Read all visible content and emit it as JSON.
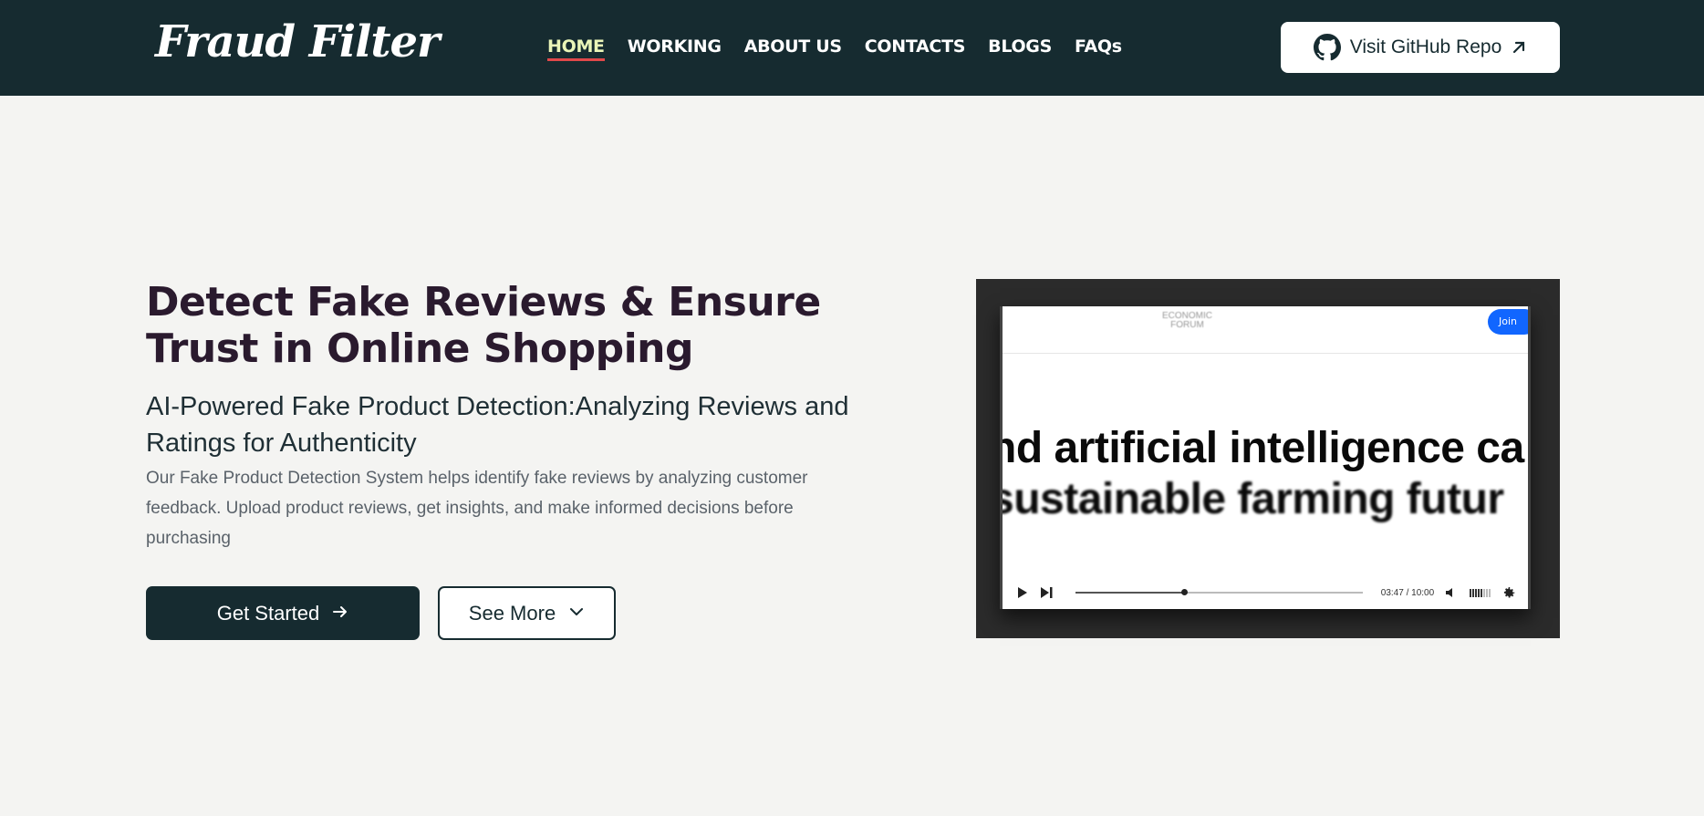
{
  "header": {
    "logo": "Fraud Filter",
    "nav": [
      {
        "label": "HOME",
        "active": true
      },
      {
        "label": "WORKING",
        "active": false
      },
      {
        "label": "ABOUT US",
        "active": false
      },
      {
        "label": "CONTACTS",
        "active": false
      },
      {
        "label": "BLOGS",
        "active": false
      },
      {
        "label": "FAQs",
        "active": false
      }
    ],
    "github_button": {
      "label": "Visit GitHub Repo",
      "icon": "github-icon",
      "trailing_icon": "arrow-up-right-icon"
    }
  },
  "hero": {
    "title": "Detect Fake Reviews & Ensure Trust in Online Shopping",
    "subtitle": "AI-Powered Fake Product Detection:Analyzing Reviews and Ratings for Authenticity",
    "description": "Our Fake Product Detection System helps identify fake reviews by analyzing customer feedback. Upload product reviews, get insights, and make informed decisions before purchasing",
    "primary_button": {
      "label": "Get Started",
      "icon": "arrow-right-icon"
    },
    "secondary_button": {
      "label": "See More",
      "icon": "chevron-down-icon"
    }
  },
  "video": {
    "logo_line1": "ECONOMIC",
    "logo_line2": "FORUM",
    "join_label": "Join",
    "caption_line1": "nd artificial intelligence ca",
    "caption_line2": "sustainable farming futur",
    "time": "03:47 / 10:00",
    "progress": 0.379,
    "volume_level": 0.6
  },
  "colors": {
    "header_bg": "#162b30",
    "page_bg": "#f4f4f2",
    "active_nav": "#eaf5b8",
    "active_underline": "#e0484a",
    "title": "#2a1a2e"
  }
}
